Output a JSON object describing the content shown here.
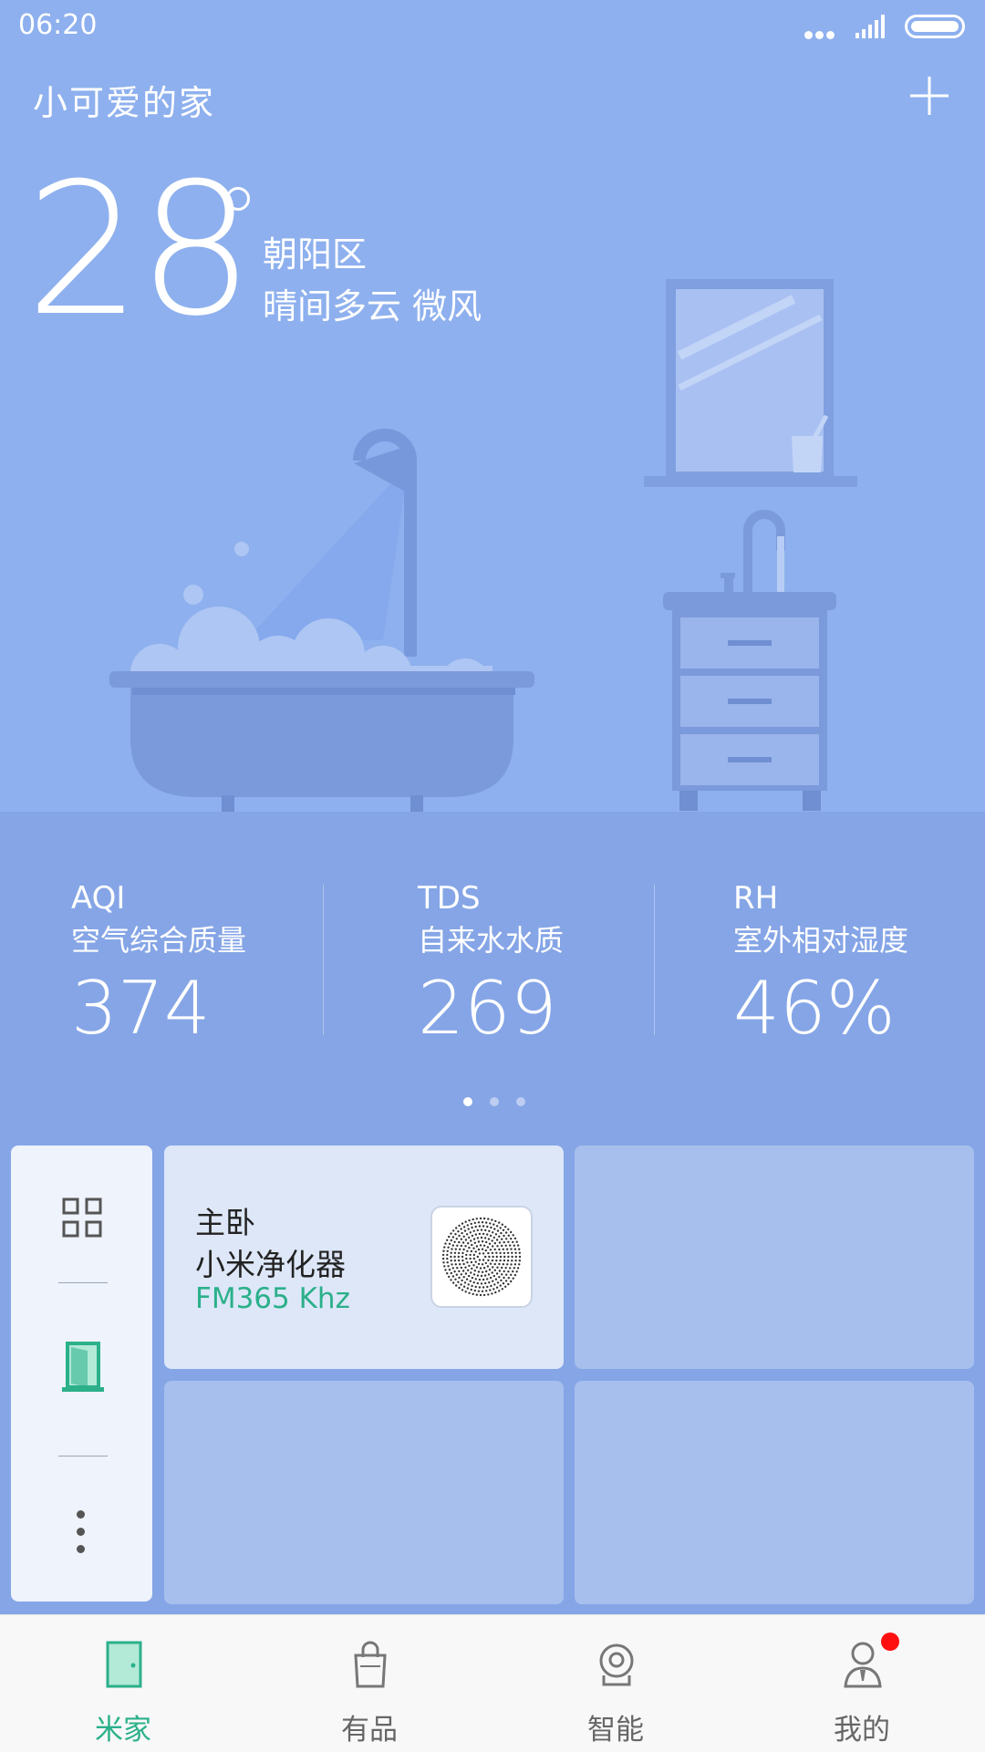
{
  "status_bar": {
    "time": "06:20"
  },
  "header": {
    "home_title": "小可爱的家"
  },
  "weather": {
    "temperature": "28",
    "district": "朝阳区",
    "condition": "晴间多云  微风"
  },
  "stats": [
    {
      "code": "AQI",
      "name": "空气综合质量",
      "value": "374"
    },
    {
      "code": "TDS",
      "name": "自来水水质",
      "value": "269"
    },
    {
      "code": "RH",
      "name": "室外相对湿度",
      "value": "46%"
    }
  ],
  "pager": {
    "count": 3,
    "active": 0
  },
  "device_tile": {
    "room": "主卧",
    "name": "小米净化器",
    "status": "FM365 Khz"
  },
  "bottom_nav": [
    {
      "label": "米家",
      "icon": "door-icon",
      "active": true
    },
    {
      "label": "有品",
      "icon": "shopping-bag-icon",
      "active": false
    },
    {
      "label": "智能",
      "icon": "camera-icon",
      "active": false
    },
    {
      "label": "我的",
      "icon": "user-icon",
      "active": false,
      "notification": true
    }
  ],
  "colors": {
    "hero_bg": "#8eb0ee",
    "stats_bg": "#85a5e6",
    "accent_green": "#2bb08a",
    "notification_red": "#ff1010"
  }
}
